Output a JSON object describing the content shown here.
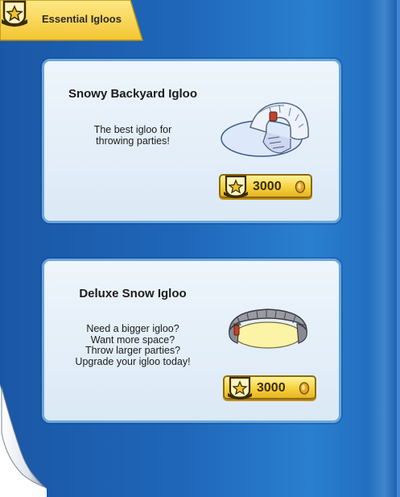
{
  "header": {
    "title": "Essential Igloos",
    "badge_icon": "star-badge-icon"
  },
  "items": [
    {
      "title": "Snowy Backyard Igloo",
      "description": [
        "The best igloo for",
        "throwing parties!"
      ],
      "price": "3000",
      "image_icon": "snowy-backyard-igloo-icon"
    },
    {
      "title": "Deluxe Snow Igloo",
      "description": [
        "Need a bigger igloo?",
        "Want more space?",
        "Throw larger parties?",
        "Upgrade your igloo today!"
      ],
      "price": "3000",
      "image_icon": "deluxe-snow-igloo-icon"
    }
  ],
  "colors": {
    "page_blue": "#1f66b9",
    "card_bg": "#dbe9f6",
    "tab_yellow": "#f7d347",
    "button_gold": "#f6d23e"
  }
}
